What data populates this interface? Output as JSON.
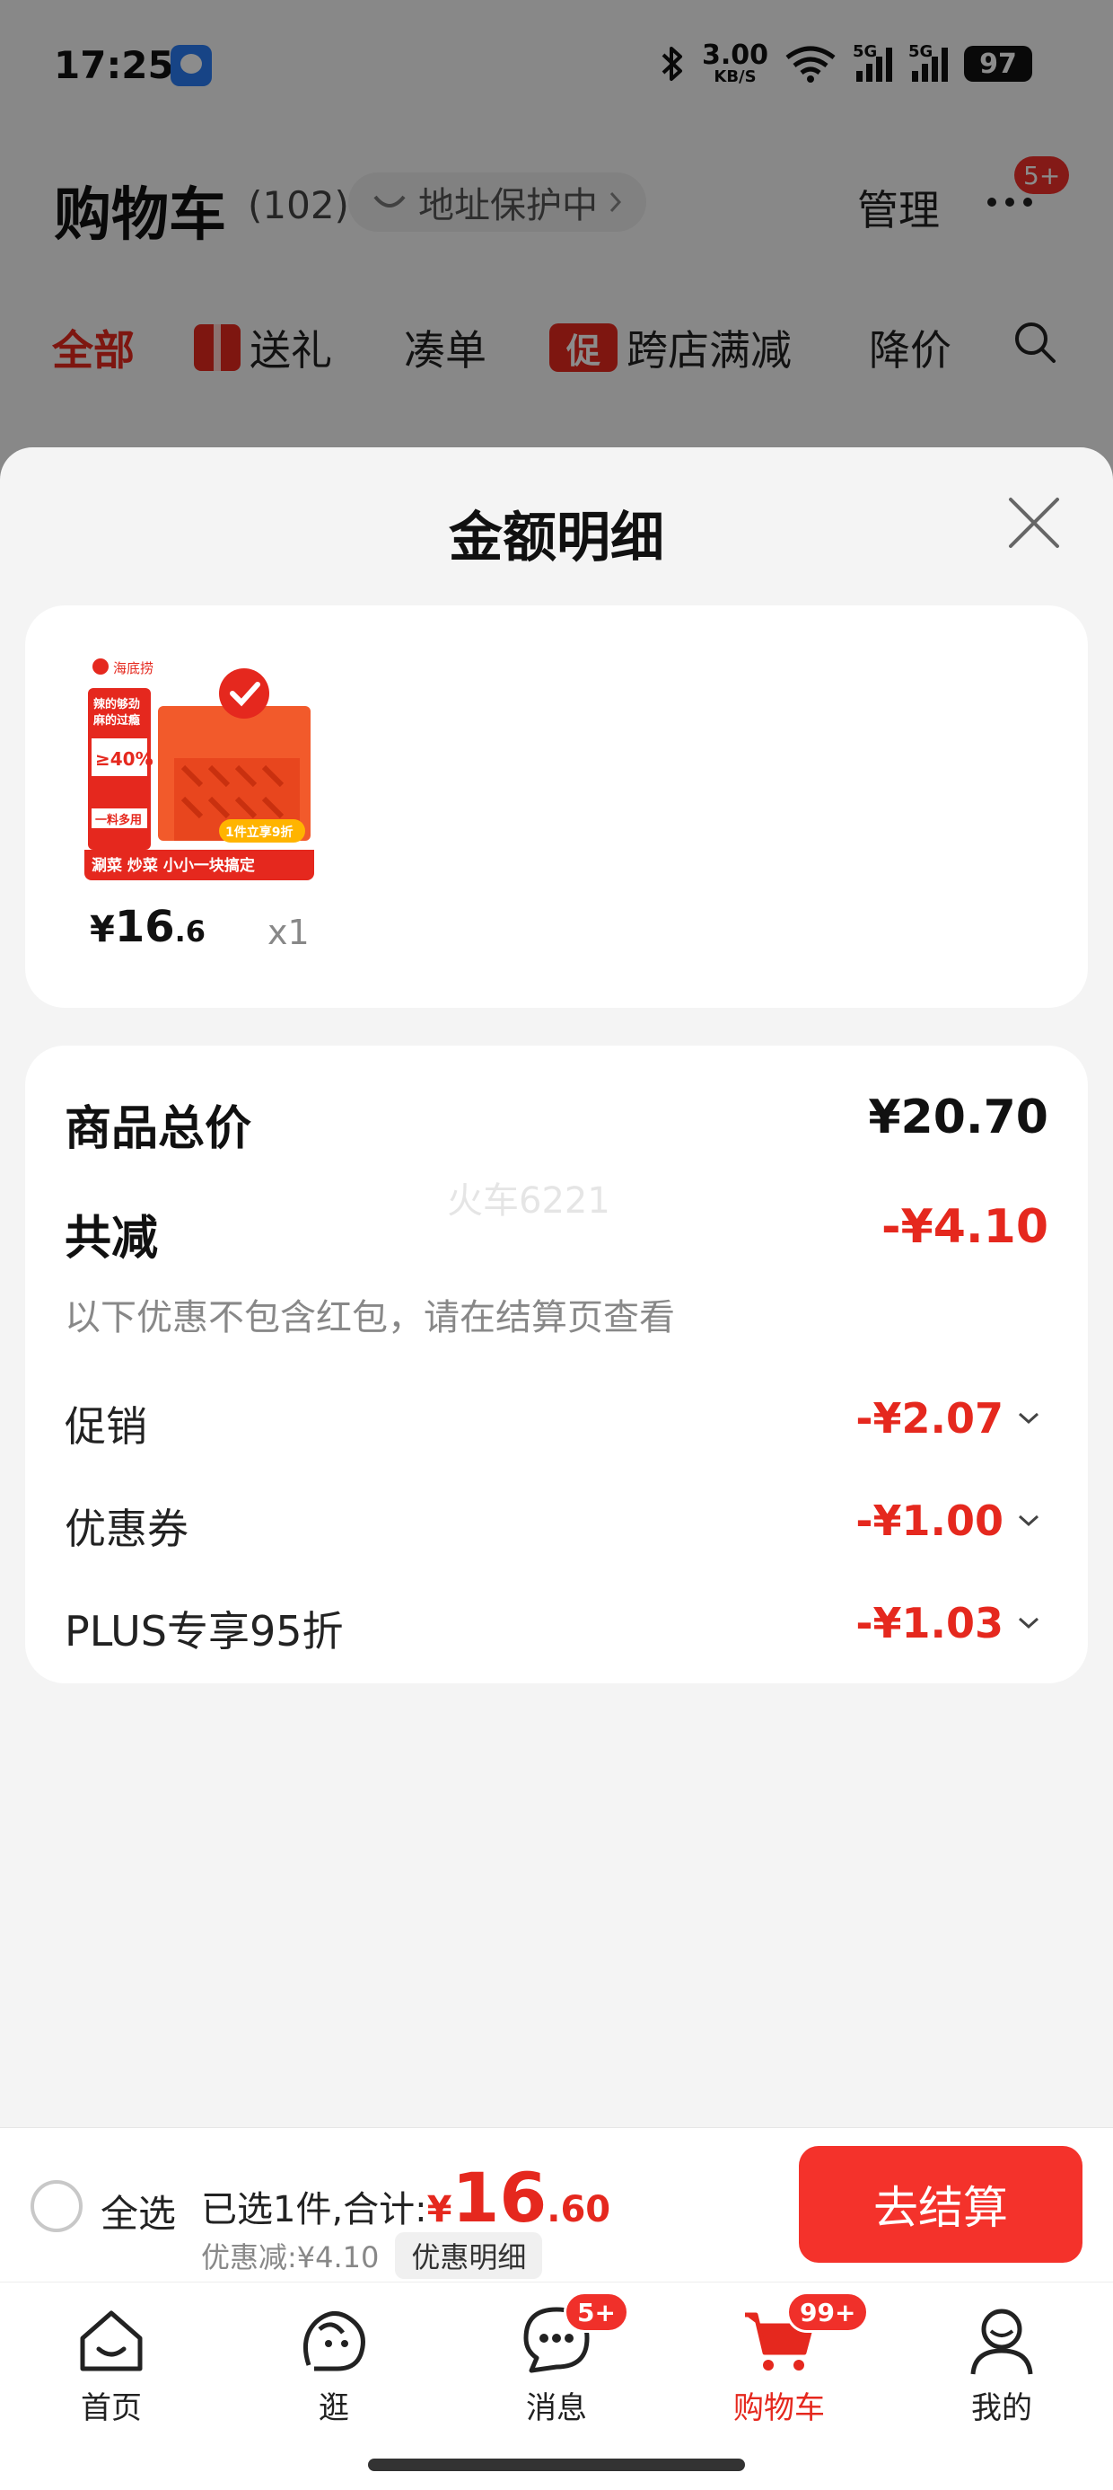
{
  "status_bar": {
    "time": "17:25",
    "net_speed_value": "3.00",
    "net_speed_unit": "KB/S",
    "signal_tag_1": "5G",
    "signal_tag_2": "5G",
    "battery": "97"
  },
  "cart_header": {
    "title": "购物车",
    "count": "(102)",
    "address_protect": "地址保护中",
    "manage": "管理",
    "more_badge": "5+"
  },
  "filter_tabs": [
    {
      "label": "全部"
    },
    {
      "label": "送礼"
    },
    {
      "label": "凑单"
    },
    {
      "label": "跨店满减",
      "icon_text": "促"
    },
    {
      "label": "降价"
    }
  ],
  "sheet": {
    "title": "金额明细",
    "watermark": "火车6221",
    "product": {
      "price_currency": "¥",
      "price_int": "16",
      "price_dec": ".6",
      "qty": "x1",
      "thumb_texts": {
        "brand": "海底捞",
        "slogan_1": "辣的够劲",
        "slogan_2": "麻的过瘾",
        "percent": "≥40%",
        "use": "一料多用",
        "bottom": "涮菜 炒菜 小小一块搞定",
        "promo": "1件立享9折"
      }
    },
    "summary": {
      "total_label": "商品总价",
      "total_value": "¥20.70",
      "reduce_label": "共减",
      "reduce_value": "-¥4.10",
      "note": "以下优惠不包含红包，请在结算页查看",
      "items": [
        {
          "label": "促销",
          "value": "-¥2.07"
        },
        {
          "label": "优惠券",
          "value": "-¥1.00"
        },
        {
          "label": "PLUS专享95折",
          "value": "-¥1.03"
        }
      ]
    }
  },
  "checkout": {
    "select_all": "全选",
    "selected_text": "已选1件,合计:",
    "currency": "¥",
    "total_int": "16",
    "total_dec": ".60",
    "discount_text": "优惠减:¥4.10",
    "detail_chip": "优惠明细",
    "checkout_button": "去结算"
  },
  "tab_bar": [
    {
      "label": "首页"
    },
    {
      "label": "逛"
    },
    {
      "label": "消息",
      "badge": "5+"
    },
    {
      "label": "购物车",
      "badge": "99+"
    },
    {
      "label": "我的"
    }
  ],
  "colors": {
    "accent_red": "#e5281e",
    "button_red": "#f4322b",
    "sheet_bg": "#f4f4f4"
  }
}
